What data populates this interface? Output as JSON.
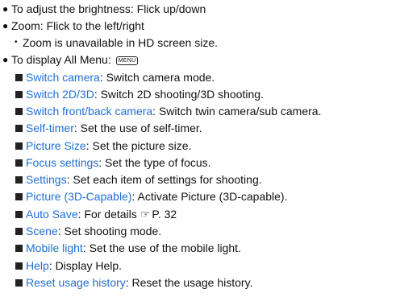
{
  "bullets": [
    {
      "text": "To adjust the brightness: Flick up/down"
    },
    {
      "text": "Zoom: Flick to the left/right"
    }
  ],
  "zoom_note": "Zoom is unavailable in HD screen size.",
  "all_menu": {
    "label": "To display All Menu:",
    "key_label": "MENU"
  },
  "menu_items": [
    {
      "link": "Switch camera",
      "desc": ": Switch camera mode."
    },
    {
      "link": "Switch 2D/3D",
      "desc": ": Switch 2D shooting/3D shooting."
    },
    {
      "link": "Switch front/back camera",
      "desc": ": Switch twin camera/sub camera."
    },
    {
      "link": "Self-timer",
      "desc": ": Set the use of self-timer."
    },
    {
      "link": "Picture Size",
      "desc": ": Set the picture size."
    },
    {
      "link": "Focus settings",
      "desc": ": Set the type of focus."
    },
    {
      "link": "Settings",
      "desc": ": Set each item of settings for shooting."
    },
    {
      "link": "Picture (3D-Capable)",
      "desc": ": Activate Picture (3D-capable)."
    },
    {
      "link": "Auto Save",
      "desc": ": For details",
      "ref_icon": "reference-hand-icon",
      "ref": "P. 32"
    },
    {
      "link": "Scene",
      "desc": ": Set shooting mode."
    },
    {
      "link": "Mobile light",
      "desc": ": Set the use of the mobile light."
    },
    {
      "link": "Help",
      "desc": ": Display Help."
    },
    {
      "link": "Reset usage history",
      "desc": ": Reset the usage history."
    }
  ],
  "colors": {
    "link": "#1f6fd6",
    "text": "#111111"
  }
}
